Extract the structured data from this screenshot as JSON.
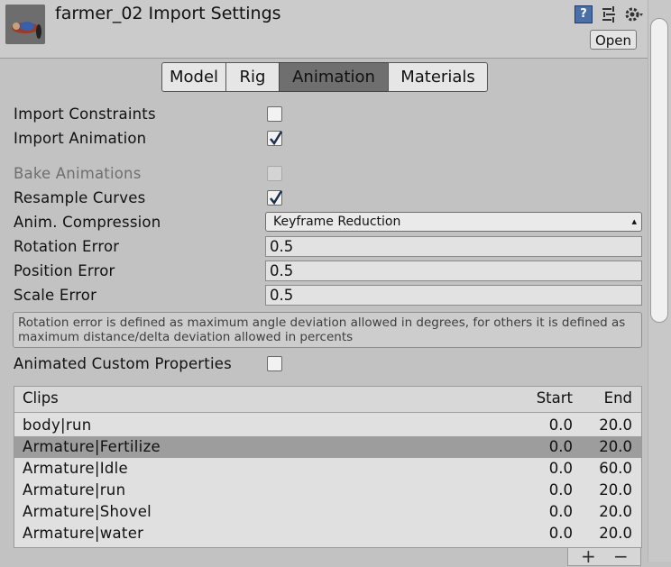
{
  "header": {
    "title": "farmer_02 Import Settings",
    "open_label": "Open",
    "icons": [
      "help-icon",
      "preset-icon",
      "gear-icon"
    ]
  },
  "tabs": [
    {
      "label": "Model",
      "active": false
    },
    {
      "label": "Rig",
      "active": false
    },
    {
      "label": "Animation",
      "active": true
    },
    {
      "label": "Materials",
      "active": false
    }
  ],
  "settings": {
    "import_constraints": {
      "label": "Import Constraints",
      "checked": false
    },
    "import_animation": {
      "label": "Import Animation",
      "checked": true
    },
    "bake_animations": {
      "label": "Bake Animations",
      "checked": false,
      "disabled": true
    },
    "resample_curves": {
      "label": "Resample Curves",
      "checked": true
    },
    "anim_compression": {
      "label": "Anim. Compression",
      "value": "Keyframe Reduction"
    },
    "rotation_error": {
      "label": "Rotation Error",
      "value": "0.5"
    },
    "position_error": {
      "label": "Position Error",
      "value": "0.5"
    },
    "scale_error": {
      "label": "Scale Error",
      "value": "0.5"
    },
    "help_text": "Rotation error is defined as maximum angle deviation allowed in degrees, for others it is defined as maximum distance/delta deviation allowed in percents",
    "animated_custom_properties": {
      "label": "Animated Custom Properties",
      "checked": false
    }
  },
  "clips": {
    "headers": {
      "name": "Clips",
      "start": "Start",
      "end": "End"
    },
    "rows": [
      {
        "name": "body|run",
        "start": "0.0",
        "end": "20.0",
        "selected": false
      },
      {
        "name": "Armature|Fertilize",
        "start": "0.0",
        "end": "20.0",
        "selected": true
      },
      {
        "name": "Armature|Idle",
        "start": "0.0",
        "end": "60.0",
        "selected": false
      },
      {
        "name": "Armature|run",
        "start": "0.0",
        "end": "20.0",
        "selected": false
      },
      {
        "name": "Armature|Shovel",
        "start": "0.0",
        "end": "20.0",
        "selected": false
      },
      {
        "name": "Armature|water",
        "start": "0.0",
        "end": "20.0",
        "selected": false
      }
    ],
    "add_label": "+",
    "remove_label": "−"
  }
}
